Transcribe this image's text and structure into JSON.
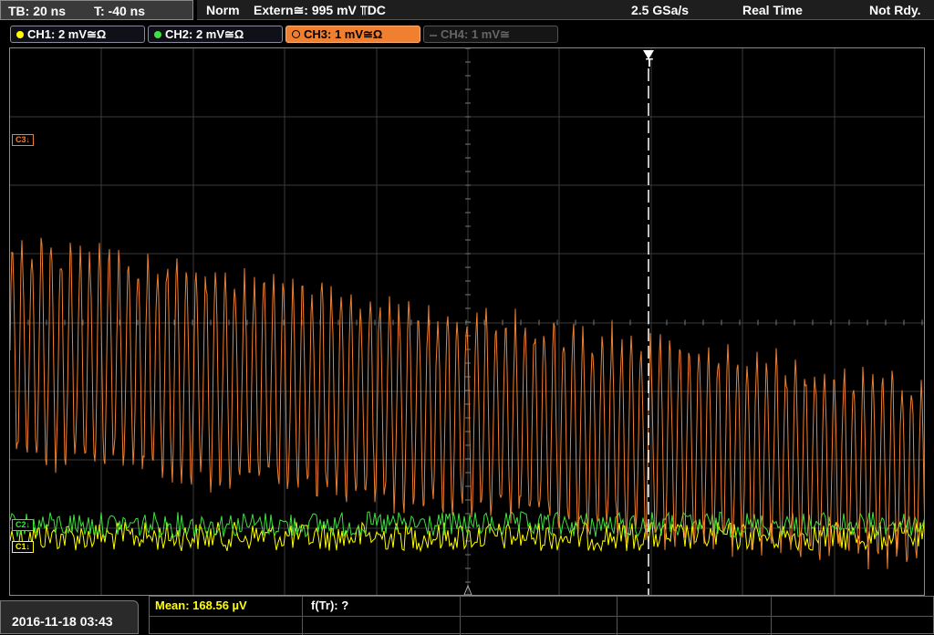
{
  "header": {
    "timebase": "TB: 20 ns",
    "trigger_offset": "T: -40 ns",
    "trigger_mode": "Norm",
    "trigger_source": "Extern≅: 995 mV ⫪DC",
    "sample_rate": "2.5 GSa/s",
    "acq_mode": "Real Time",
    "status": "Not Rdy."
  },
  "channels": [
    {
      "label": "CH1: 2 mV≅Ω",
      "color": "#ffff00",
      "state": "on"
    },
    {
      "label": "CH2: 2 mV≅Ω",
      "color": "#40e040",
      "state": "on"
    },
    {
      "label": "CH3: 1 mV≅Ω",
      "color": "#f08030",
      "state": "active"
    },
    {
      "label": "CH4: 1 mV≅",
      "color": "#555555",
      "state": "off"
    }
  ],
  "markers": {
    "c3": "C3↓",
    "c2": "C2↓",
    "c1": "C1↓",
    "trigger": "T"
  },
  "footer": {
    "datetime": "2016-11-18 03:43",
    "mean": "Mean: 168.56 µV",
    "freq": "f(Tr): ?"
  },
  "colors": {
    "ch1": "#ffff00",
    "ch2": "#40e040",
    "ch3": "#f08030",
    "grid": "#3a3a3a",
    "trigger_line": "#ffffff"
  }
}
